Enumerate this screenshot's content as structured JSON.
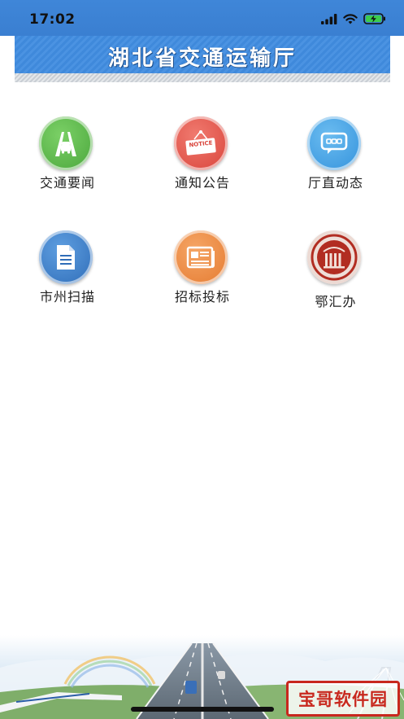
{
  "status_bar": {
    "time": "17:02"
  },
  "header": {
    "title": "湖北省交通运输厅"
  },
  "grid": [
    {
      "label": "交通要闻",
      "icon": "car-road-icon",
      "color": "#58b548"
    },
    {
      "label": "通知公告",
      "icon": "notice-icon",
      "color": "#e2544a",
      "icon_text": "NOTICE"
    },
    {
      "label": "厅直动态",
      "icon": "chat-bubble-icon",
      "color": "#3c9ee4"
    },
    {
      "label": "市州扫描",
      "icon": "document-icon",
      "color": "#3d7ec6"
    },
    {
      "label": "招标投标",
      "icon": "newspaper-icon",
      "color": "#ec8a3e"
    },
    {
      "label": "鄂汇办",
      "icon": "ehuiban-logo-icon",
      "color": "#b22d22"
    }
  ],
  "watermark": {
    "text": "宝哥软件园"
  }
}
